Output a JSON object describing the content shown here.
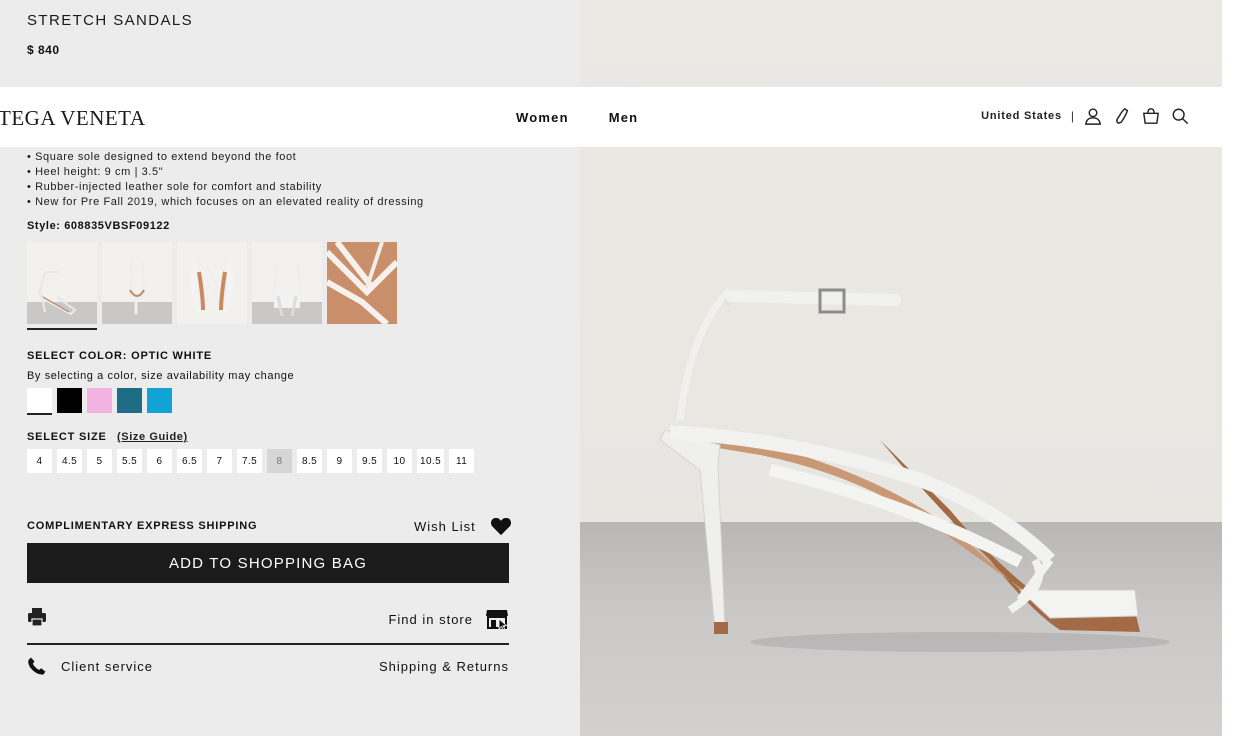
{
  "product": {
    "title": "STRETCH SANDALS",
    "price": "$ 840"
  },
  "header": {
    "brand": "TEGA VENETA",
    "nav": [
      "Women",
      "Men"
    ],
    "country": "United States",
    "separator": "|",
    "icons": [
      "user-icon",
      "phone-icon",
      "bag-icon",
      "search-icon"
    ]
  },
  "details": {
    "bullets": [
      "Square sole designed to extend beyond the foot",
      "Heel height: 9 cm | 3.5\"",
      "Rubber-injected leather sole for comfort and stability",
      "New for Pre Fall 2019, which focuses on an elevated reality of dressing"
    ],
    "style_label": "Style:",
    "style_code": "608835VBSF09122"
  },
  "colors": {
    "label": "SELECT COLOR: OPTIC WHITE",
    "note": "By selecting a color, size availability may change",
    "swatches": [
      "#ffffff",
      "#000000",
      "#f2b3e3",
      "#1e6c86",
      "#11a3d6"
    ],
    "selected_index": 0
  },
  "sizes": {
    "label": "SELECT SIZE",
    "guide": "(Size Guide)",
    "options": [
      "4",
      "4.5",
      "5",
      "5.5",
      "6",
      "6.5",
      "7",
      "7.5",
      "8",
      "8.5",
      "9",
      "9.5",
      "10",
      "10.5",
      "11"
    ],
    "unavailable": [
      "8"
    ]
  },
  "actions": {
    "shipping": "COMPLIMENTARY EXPRESS SHIPPING",
    "wishlist": "Wish List",
    "add_to_bag": "ADD TO SHOPPING BAG",
    "find_in_store": "Find in store",
    "client_service": "Client service",
    "shipping_returns": "Shipping & Returns"
  }
}
